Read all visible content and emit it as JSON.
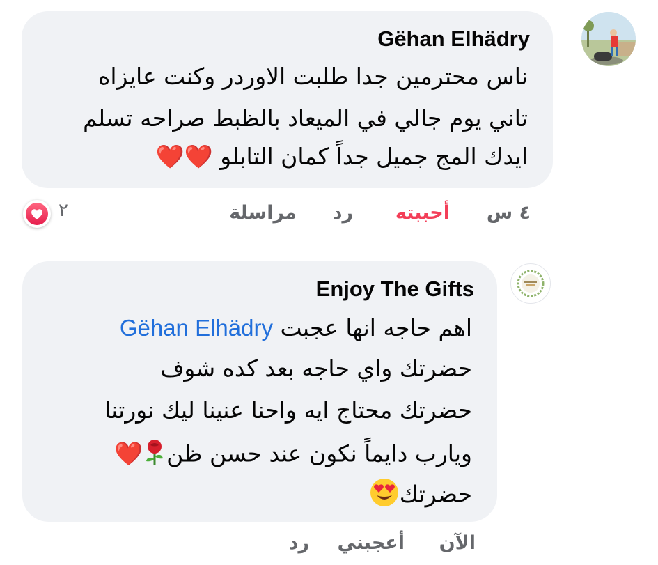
{
  "comments": [
    {
      "author": "Gëhan Elhädry",
      "lines": [
        "ناس محترمين جدا طلبت الاوردر وكنت عايزاه",
        "تاني يوم جالي في الميعاد بالظبط صراحه تسلم",
        "ايدك المج جميل جداً كمان التابلو"
      ],
      "trailing_emoji": "❤️❤️",
      "time": "٤ س",
      "like_label": "أحببته",
      "reply_label": "رد",
      "message_label": "مراسلة",
      "reaction_count": "٢",
      "reaction_icon": "love-reaction-icon"
    },
    {
      "author": "Enjoy The Gifts",
      "mention": "Gëhan Elhädry",
      "line1_text": "اهم حاجه انها عجبت",
      "lines": [
        "حضرتك واي حاجه بعد كده شوف",
        "حضرتك محتاج ايه واحنا عنينا ليك نورتنا",
        "ويارب دايماً نكون عند حسن ظن",
        "حضرتك"
      ],
      "line4_emoji": "❤️",
      "time": "الآن",
      "like_label": "أعجبني",
      "reply_label": "رد"
    }
  ],
  "colors": {
    "bubble": "#f0f2f5",
    "mention": "#216fdb",
    "liked": "#f33e58",
    "meta": "#65676b",
    "heart": "#e0202e"
  }
}
